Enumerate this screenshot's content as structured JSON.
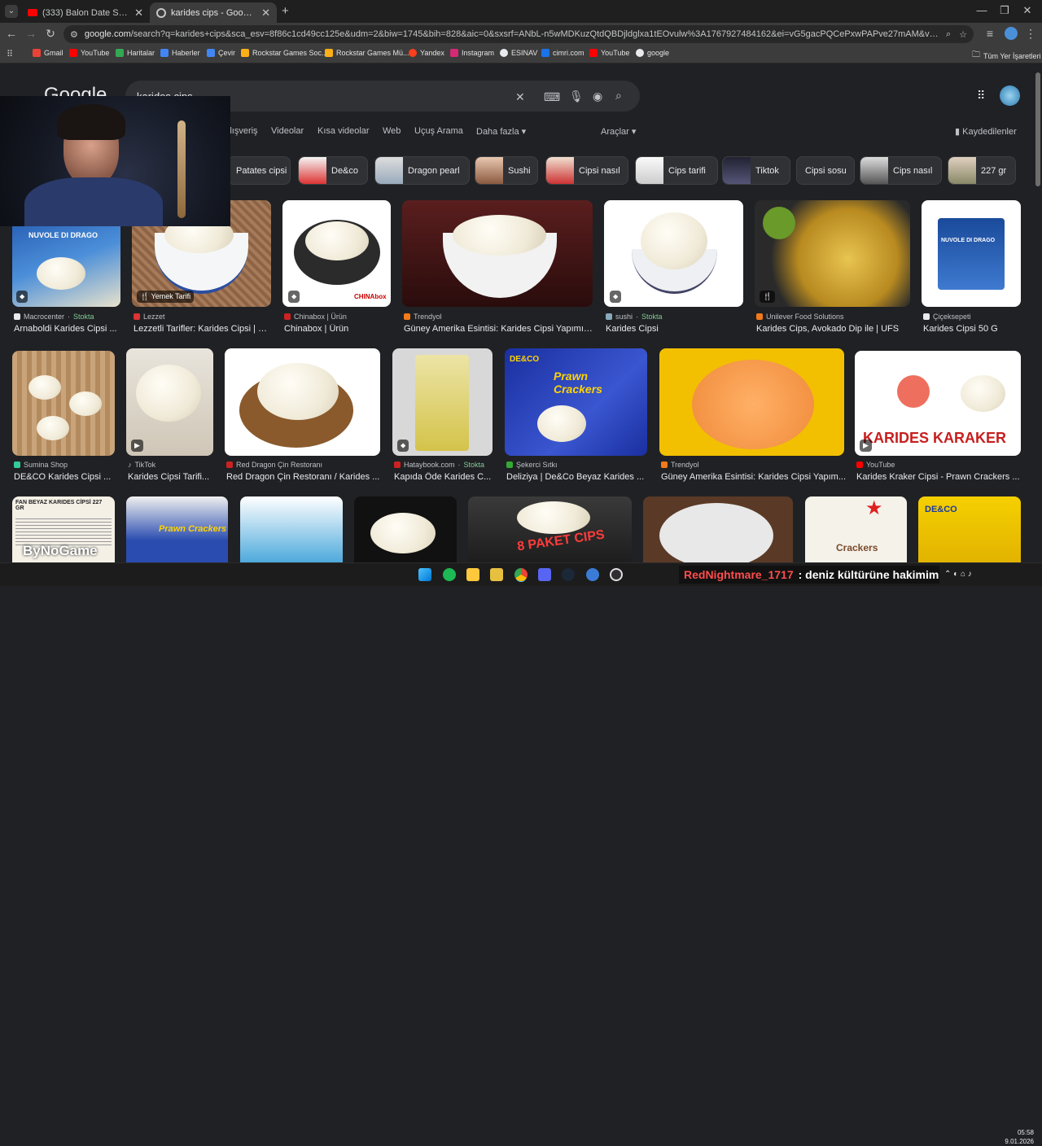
{
  "browser": {
    "tabs": [
      {
        "title": "(333) Balon Date Show 36. Bölü",
        "favicon": "youtube-icon",
        "active": false
      },
      {
        "title": "karides cips - Google'da Ara",
        "favicon": "google-icon",
        "active": true
      }
    ],
    "new_tab": "+",
    "url_host": "google.com",
    "url_rest": "/search?q=karides+cips&sca_esv=8f86c1cd49cc125e&udm=2&biw=1745&bih=828&aic=0&sxsrf=ANbL-n5wMDKuzQtdQBDjldglxa1tEOvulw%3A1767927484162&ei=vG5gacPQCePxwPAPve27mAM&ved=0ahUKEwjDnrqNu_2RAxXjOBAIHb3...",
    "bookmarks": [
      {
        "label": "Gmail",
        "color": "#ea4335"
      },
      {
        "label": "YouTube",
        "color": "#ff0000"
      },
      {
        "label": "Haritalar",
        "color": "#34a853"
      },
      {
        "label": "Haberler",
        "color": "#4285f4"
      },
      {
        "label": "Çevir",
        "color": "#4285f4"
      },
      {
        "label": "Rockstar Games Soc...",
        "color": "#fcaf17"
      },
      {
        "label": "Rockstar Games Mü...",
        "color": "#fcaf17"
      },
      {
        "label": "Yandex",
        "color": "#fc3f1d"
      },
      {
        "label": "Instagram",
        "color": "#d62976"
      },
      {
        "label": "ESINAV",
        "color": "#e8eaed"
      },
      {
        "label": "cimri.com",
        "color": "#1a73e8"
      },
      {
        "label": "YouTube",
        "color": "#ff0000"
      },
      {
        "label": "google",
        "color": "#e8eaed"
      }
    ],
    "all_bookmarks": "Tüm Yer İşaretleri"
  },
  "search": {
    "logo": "Google",
    "query": "karides cips",
    "nav_tabs": [
      "Alışveriş",
      "Videolar",
      "Kısa videolar",
      "Web",
      "Uçuş Arama",
      "Daha fazla"
    ],
    "tools": "Araçlar",
    "saved": "Kaydedilenler",
    "chips": [
      "Patates cipsi",
      "De&co",
      "Dragon pearl",
      "Sushi",
      "Cipsi nasıl",
      "Cips tarifi",
      "Tiktok",
      "Cipsi sosu",
      "Cips nasıl",
      "227 gr"
    ]
  },
  "results_row1": [
    {
      "source": "Macrocenter",
      "stock": "Stokta",
      "title": "Arnaboldi Karides Cipsi ...",
      "badge": ""
    },
    {
      "source": "Lezzet",
      "stock": "",
      "title": "Lezzetli Tarifler: Karides Cipsi | L...",
      "badge": "Yemek Tarifi"
    },
    {
      "source": "Chinabox | Ürün",
      "stock": "",
      "title": "Chinabox | Ürün",
      "badge": ""
    },
    {
      "source": "Trendyol",
      "stock": "",
      "title": "Güney Amerika Esintisi: Karides Cipsi Yapımı ...",
      "badge": ""
    },
    {
      "source": "sushi",
      "stock": "Stokta",
      "title": "Karides Cipsi",
      "badge": ""
    },
    {
      "source": "Unilever Food Solutions",
      "stock": "",
      "title": "Karides Cips, Avokado Dip ile | UFS",
      "badge": ""
    },
    {
      "source": "Çiçeksepeti",
      "stock": "",
      "title": "Karides Cipsi 50 G",
      "badge": ""
    }
  ],
  "results_row2": [
    {
      "source": "Sumina Shop",
      "stock": "",
      "title": "DE&CO Karides Cipsi ..."
    },
    {
      "source": "TikTok",
      "stock": "",
      "title": "Karides Cipsi Tarifi..."
    },
    {
      "source": "Red Dragon Çin Restoranı",
      "stock": "",
      "title": "Red Dragon Çin Restoranı / Karides ..."
    },
    {
      "source": "Hataybook.com",
      "stock": "Stokta",
      "title": "Kapıda Öde Karides C..."
    },
    {
      "source": "Şekerci Sıtkı",
      "stock": "",
      "title": "Deliziya | De&Co Beyaz Karides ..."
    },
    {
      "source": "Trendyol",
      "stock": "",
      "title": "Güney Amerika Esintisi: Karides Cipsi Yapım..."
    },
    {
      "source": "YouTube",
      "stock": "",
      "title": "Karides Kraker Cipsi - Prawn Crackers ..."
    }
  ],
  "image_text": {
    "nuvole": "NUVOLE DI DRAGO",
    "chinabox": "CHINAbox",
    "prawn_crackers": "Prawn Crackers",
    "deco": "DE&CO",
    "karides_karaker": "KARIDES KARAKER",
    "fan_beyaz": "FAN BEYAZ KARIDES CİPSİ 227 GR",
    "bynogame": "ByNoGame",
    "paket_cips": "8 PAKET CIPS",
    "crackers": "Crackers"
  },
  "stream": {
    "chat_user": "RedNightmare_1717",
    "chat_message": ": deniz kültürüne hakimim"
  },
  "taskbar": {
    "time": "05:58",
    "date": "9.01.2026"
  }
}
